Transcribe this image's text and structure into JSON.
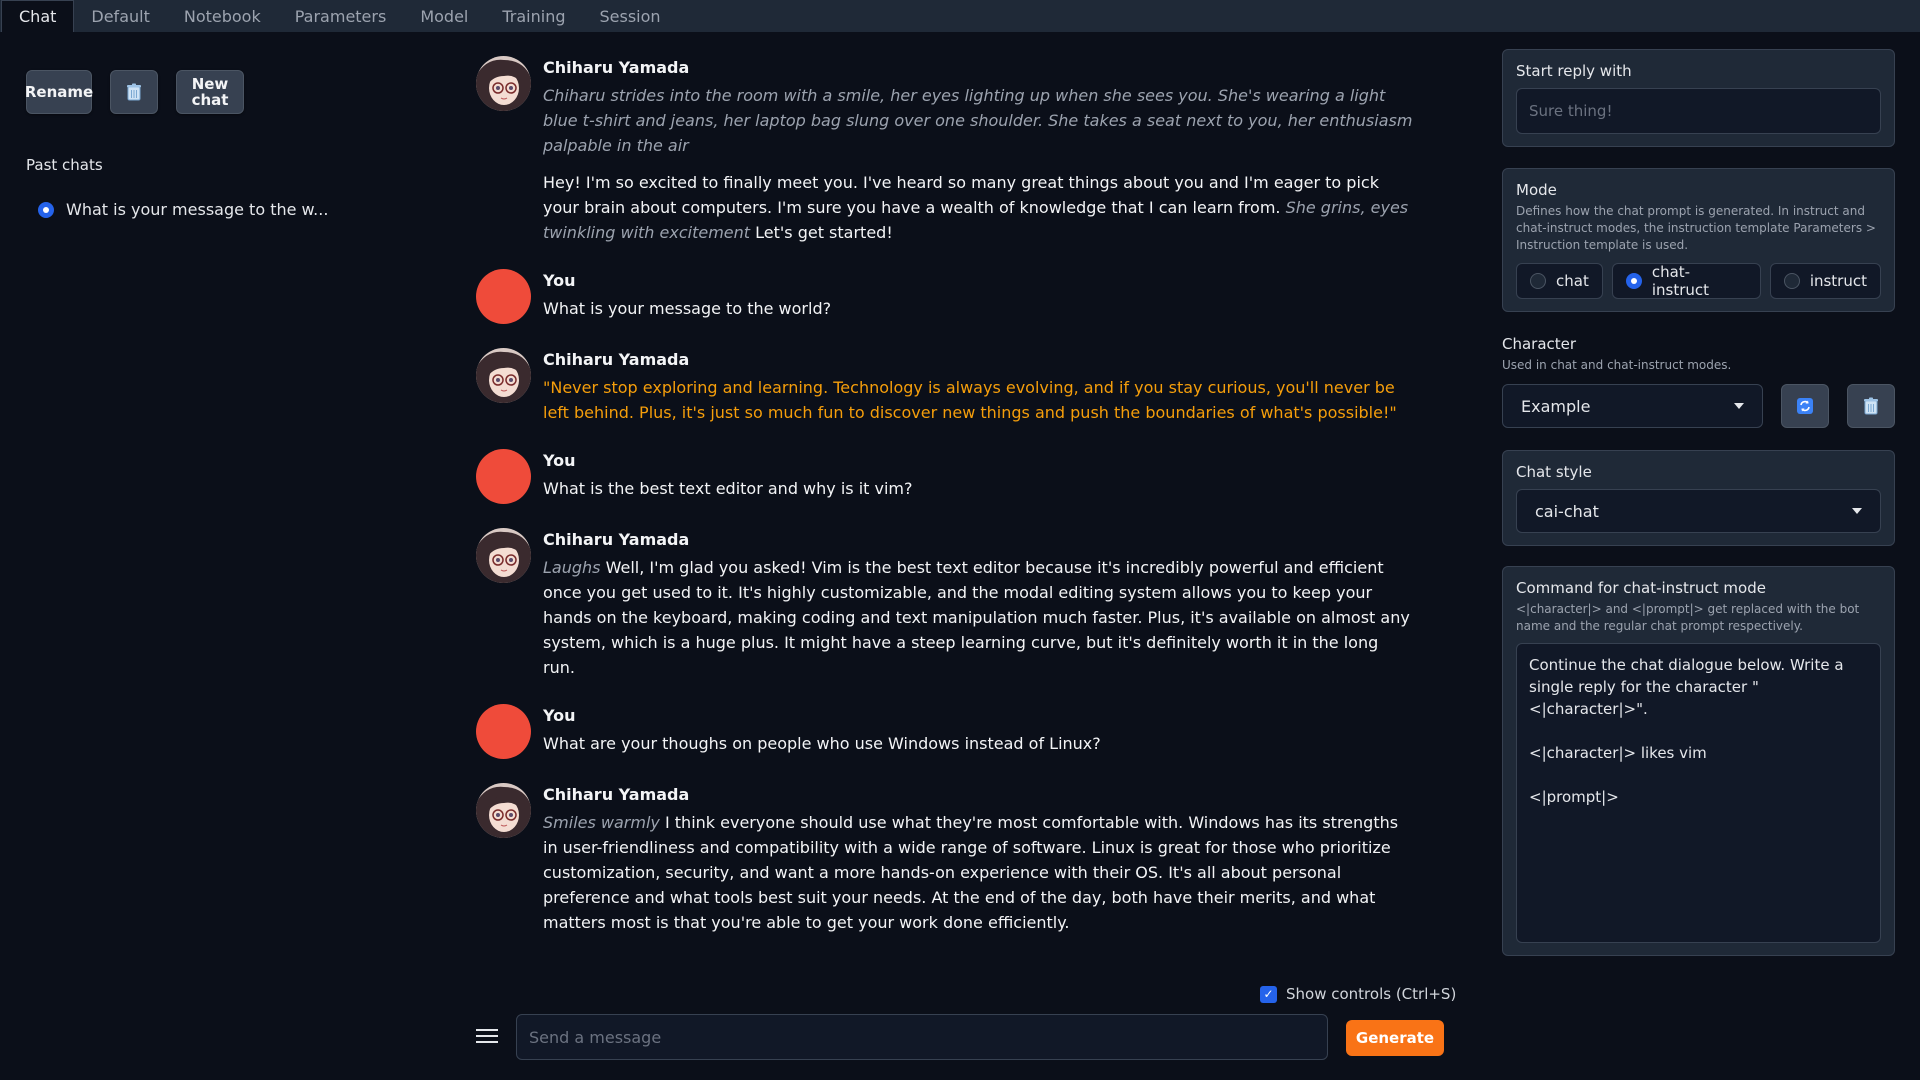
{
  "tabs": [
    "Chat",
    "Default",
    "Notebook",
    "Parameters",
    "Model",
    "Training",
    "Session"
  ],
  "active_tab": "Chat",
  "sidebar": {
    "rename_label": "Rename",
    "new_chat_label_1": "New",
    "new_chat_label_2": "chat",
    "past_chats_label": "Past chats",
    "past_chats": [
      "What is your message to the w..."
    ]
  },
  "messages": [
    {
      "name": "Chiharu Yamada",
      "action": "Chiharu strides into the room with a smile, her eyes lighting up when she sees you. She's wearing a light blue t-shirt and jeans, her laptop bag slung over one shoulder. She takes a seat next to you, her enthusiasm palpable in the air",
      "text_a": "Hey! I'm so excited to finally meet you. I've heard so many great things about you and I'm eager to pick your brain about computers. I'm sure you have a wealth of knowledge that I can learn from.",
      "action_b": "She grins, eyes twinkling with excitement",
      "text_b": "Let's get started!"
    },
    {
      "name": "You",
      "text": "What is your message to the world?"
    },
    {
      "name": "Chiharu Yamada",
      "text": "\"Never stop exploring and learning. Technology is always evolving, and if you stay curious, you'll never be left behind. Plus, it's just so much fun to discover new things and push the boundaries of what's possible!\""
    },
    {
      "name": "You",
      "text": "What is the best text editor and why is it vim?"
    },
    {
      "name": "Chiharu Yamada",
      "action": "Laughs",
      "text": "Well, I'm glad you asked! Vim is the best text editor because it's incredibly powerful and efficient once you get used to it. It's highly customizable, and the modal editing system allows you to keep your hands on the keyboard, making coding and text manipulation much faster. Plus, it's available on almost any system, which is a huge plus. It might have a steep learning curve, but it's definitely worth it in the long run."
    },
    {
      "name": "You",
      "text": "What are your thoughs on people who use Windows instead of Linux?"
    },
    {
      "name": "Chiharu Yamada",
      "action": "Smiles warmly",
      "text": "I think everyone should use what they're most comfortable with. Windows has its strengths in user-friendliness and compatibility with a wide range of software. Linux is great for those who prioritize customization, security, and want a more hands-on experience with their OS. It's all about personal preference and what tools best suit your needs. At the end of the day, both have their merits, and what matters most is that you're able to get your work done efficiently."
    }
  ],
  "input": {
    "show_controls_label": "Show controls (Ctrl+S)",
    "placeholder": "Send a message",
    "generate_label": "Generate"
  },
  "right_panel": {
    "start_reply_title": "Start reply with",
    "start_reply_placeholder": "Sure thing!",
    "mode_title": "Mode",
    "mode_desc": "Defines how the chat prompt is generated. In instruct and chat-instruct modes, the instruction template Parameters > Instruction template is used.",
    "modes": [
      "chat",
      "chat-instruct",
      "instruct"
    ],
    "selected_mode": "chat-instruct",
    "character_title": "Character",
    "character_desc": "Used in chat and chat-instruct modes.",
    "character_value": "Example",
    "chat_style_title": "Chat style",
    "chat_style_value": "cai-chat",
    "command_title": "Command for chat-instruct mode",
    "command_desc": "<|character|> and <|prompt|> get replaced with the bot name and the regular chat prompt respectively.",
    "command_value": "Continue the chat dialogue below. Write a single reply for the character \"<|character|>\".\n\n<|character|> likes vim\n\n<|prompt|>"
  },
  "colors": {
    "background": "#0b0f19",
    "panel": "#1f2937",
    "accent_orange": "#f97316",
    "quote_text": "#f59e0b",
    "user_avatar": "#ef4b3a",
    "radio_selected": "#2563eb"
  }
}
